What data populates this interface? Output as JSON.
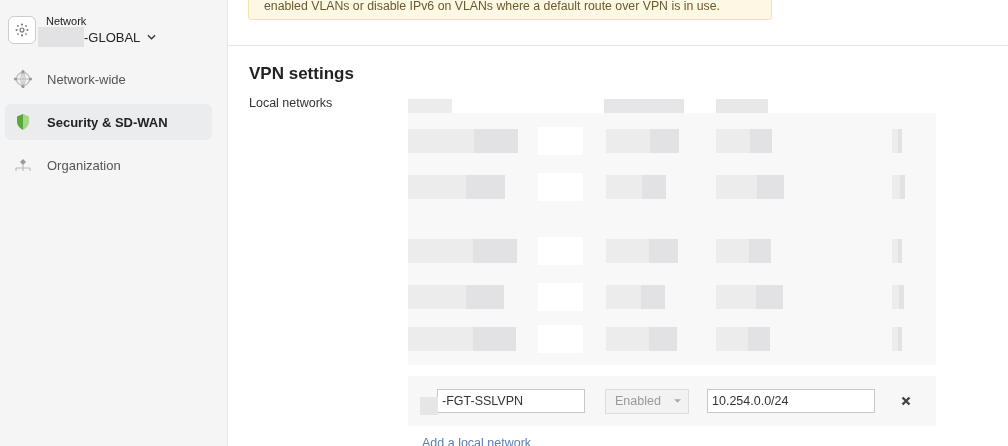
{
  "sidebar": {
    "network_label": "Network",
    "network_name": "-GLOBAL",
    "items": [
      {
        "label": "Network-wide",
        "selected": false
      },
      {
        "label": "Security & SD-WAN",
        "selected": true
      },
      {
        "label": "Organization",
        "selected": false
      }
    ]
  },
  "banner": {
    "text": "enabled VLANs or disable IPv6 on VLANs where a default route over VPN is in use."
  },
  "section": {
    "title": "VPN settings",
    "label": "Local networks"
  },
  "local_networks": {
    "rows": [
      {
        "name": "-FGT-SSLVPN",
        "vpn_mode": "Enabled",
        "vpn_mode_disabled": true,
        "subnet": "10.254.0.0/24"
      }
    ],
    "add_link": "Add a local network"
  }
}
